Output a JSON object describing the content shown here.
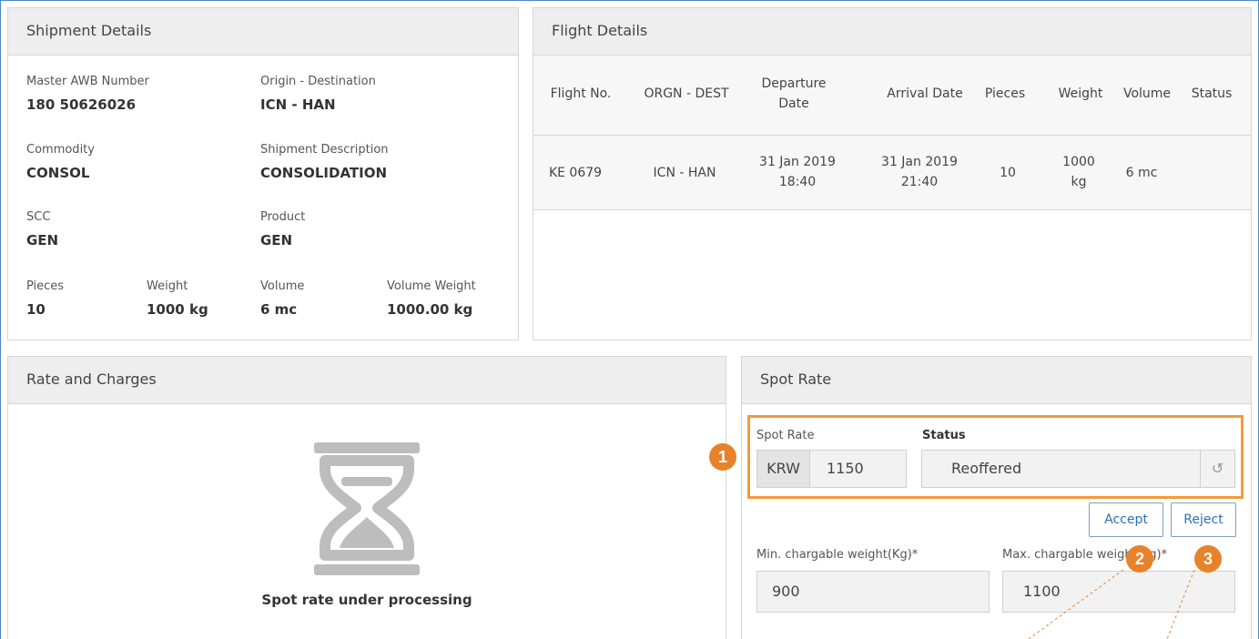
{
  "shipment": {
    "title": "Shipment Details",
    "master_awb_label": "Master AWB Number",
    "master_awb_value": "180 50626026",
    "orig_dest_label": "Origin - Destination",
    "orig_dest_value": "ICN - HAN",
    "commodity_label": "Commodity",
    "commodity_value": "CONSOL",
    "description_label": "Shipment Description",
    "description_value": "CONSOLIDATION",
    "scc_label": "SCC",
    "scc_value": "GEN",
    "product_label": "Product",
    "product_value": "GEN",
    "pieces_label": "Pieces",
    "pieces_value": "10",
    "weight_label": "Weight",
    "weight_value": "1000 kg",
    "volume_label": "Volume",
    "volume_value": "6 mc",
    "volume_weight_label": "Volume Weight",
    "volume_weight_value": "1000.00 kg"
  },
  "flight": {
    "title": "Flight Details",
    "headers": {
      "flight_no": "Flight No.",
      "orgn_dest": "ORGN - DEST",
      "departure_line1": "Departure",
      "departure_line2": "Date",
      "arrival": "Arrival Date",
      "pieces": "Pieces",
      "weight": "Weight",
      "volume": "Volume",
      "status": "Status"
    },
    "rows": [
      {
        "flight_no": "KE 0679",
        "orgn_dest": "ICN - HAN",
        "departure_date": "31 Jan 2019",
        "departure_time": "18:40",
        "arrival_date": "31 Jan 2019",
        "arrival_time": "21:40",
        "pieces": "10",
        "weight_num": "1000",
        "weight_unit": "kg",
        "volume": "6 mc",
        "status": ""
      }
    ]
  },
  "rate": {
    "title": "Rate and Charges",
    "processing_text": "Spot rate under processing",
    "icon": "hourglass-icon"
  },
  "spot": {
    "title": "Spot Rate",
    "rate_label": "Spot Rate",
    "currency": "KRW",
    "rate_value": "1150",
    "status_label": "Status",
    "status_value": "Reoffered",
    "history_icon": "history-icon",
    "accept_label": "Accept",
    "reject_label": "Reject",
    "min_weight_label": "Min. chargable weight(Kg)*",
    "min_weight_value": "900",
    "max_weight_label": "Max. chargable weight(Kg)*",
    "max_weight_value": "1100"
  },
  "annotations": {
    "badge1": "1",
    "badge2": "2",
    "badge3": "3",
    "color": "#e8822a",
    "highlight_color": "#f29b38"
  }
}
